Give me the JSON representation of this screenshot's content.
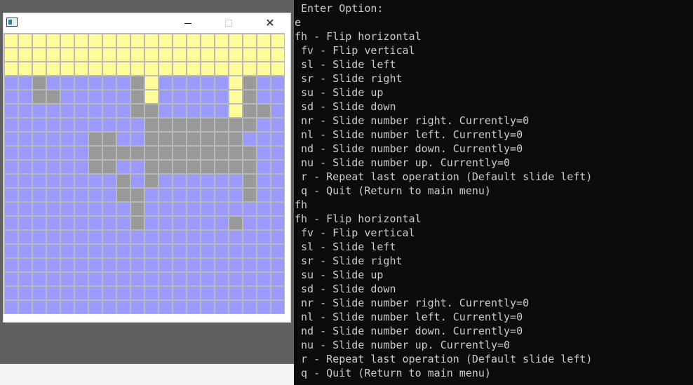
{
  "window": {
    "min_icon": "minimize-icon",
    "max_icon": "maximize-icon",
    "close_icon": "close-icon",
    "close_glyph": "✕"
  },
  "grid": {
    "rows": 20,
    "cols": 20,
    "colors": {
      "0": "#9a9aff",
      "1": "#9a9a9a",
      "2": "#fefc9a"
    },
    "cells": [
      "22222222222222222222",
      "22222222222222222222",
      "22222222222222222222",
      "00100000012000002100",
      "00110000012000002100",
      "00000000011000002110",
      "00000000001111111100",
      "00000011001111111000",
      "00000011111111111100",
      "00000011001111111100",
      "00000000101000000100",
      "00000000110000000100",
      "00000000010000000000",
      "00000000010000001000",
      "00000000000000000000",
      "00000000000000000000",
      "00000000000000000000",
      "00000000000000000000",
      "00000000000000000000",
      "00000000000000000000"
    ]
  },
  "console": {
    "lines": [
      " Enter Option:",
      "e",
      "fh - Flip horizontal",
      " fv - Flip vertical",
      " sl - Slide left",
      " sr - Slide right",
      " su - Slide up",
      " sd - Slide down",
      " nr - Slide number right. Currently=0",
      " nl - Slide number left. Currently=0",
      " nd - Slide number down. Currently=0",
      " nu - Slide number up. Currently=0",
      " r - Repeat last operation (Default slide left)",
      " q - Quit (Return to main menu)",
      "fh",
      "fh - Flip horizontal",
      " fv - Flip vertical",
      " sl - Slide left",
      " sr - Slide right",
      " su - Slide up",
      " sd - Slide down",
      " nr - Slide number right. Currently=0",
      " nl - Slide number left. Currently=0",
      " nd - Slide number down. Currently=0",
      " nu - Slide number up. Currently=0",
      " r - Repeat last operation (Default slide left)",
      " q - Quit (Return to main menu)"
    ]
  }
}
